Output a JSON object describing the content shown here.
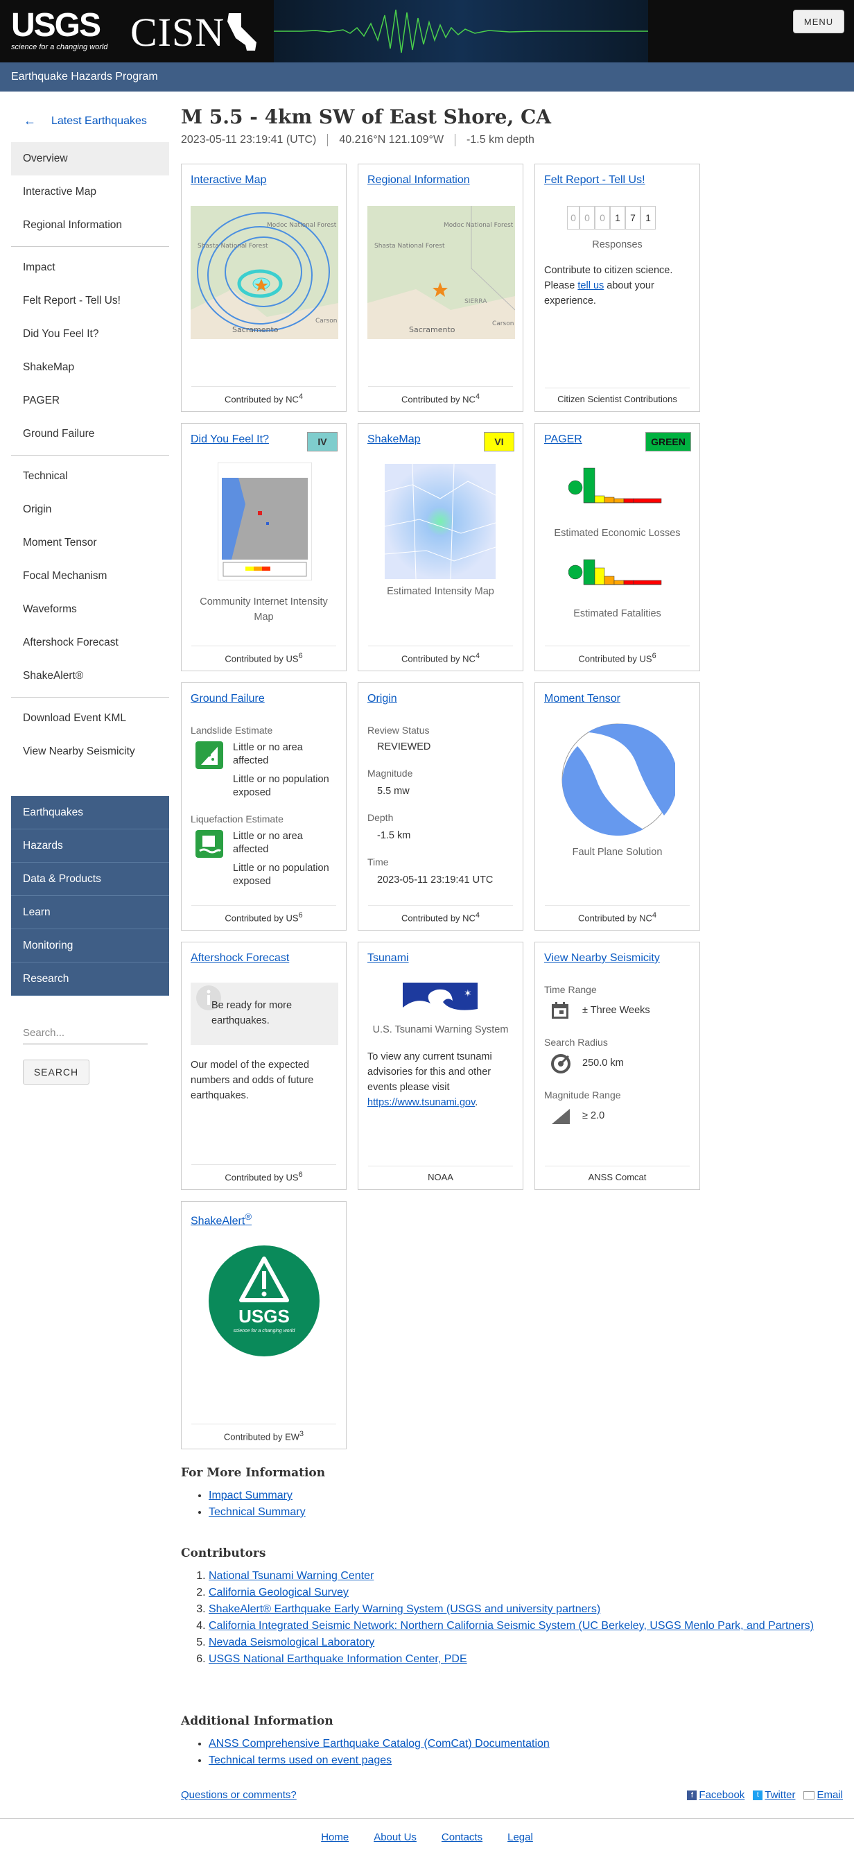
{
  "header": {
    "usgs_word": "USGS",
    "usgs_tagline": "science for a changing world",
    "cisn_word": "CISN",
    "menu_label": "MENU",
    "program": "Earthquake Hazards Program"
  },
  "sidebar": {
    "back_label": "Latest Earthquakes",
    "items": [
      "Overview",
      "Interactive Map",
      "Regional Information",
      "Impact",
      "Felt Report - Tell Us!",
      "Did You Feel It?",
      "ShakeMap",
      "PAGER",
      "Ground Failure",
      "Technical",
      "Origin",
      "Moment Tensor",
      "Focal Mechanism",
      "Waveforms",
      "Aftershock Forecast",
      "ShakeAlert®",
      "Download Event KML",
      "View Nearby Seismicity"
    ],
    "blue_items": [
      "Earthquakes",
      "Hazards",
      "Data & Products",
      "Learn",
      "Monitoring",
      "Research"
    ],
    "search_placeholder": "Search...",
    "search_button": "SEARCH"
  },
  "event": {
    "title": "M 5.5 - 4km SW of East Shore, CA",
    "time": "2023-05-11 23:19:41 (UTC)",
    "location": "40.216°N 121.109°W",
    "depth": "-1.5 km depth"
  },
  "cards": {
    "interactive_map": {
      "title": "Interactive Map",
      "foot_prefix": "Contributed by ",
      "foot_net": "NC",
      "foot_sup": "4",
      "map_labels": [
        "Modoc National Forest",
        "Shasta National Forest",
        "Sacramento",
        "Carson"
      ]
    },
    "regional": {
      "title": "Regional Information",
      "foot_prefix": "Contributed by ",
      "foot_net": "NC",
      "foot_sup": "4",
      "map_labels": [
        "Modoc National Forest",
        "Shasta National Forest",
        "Sacramento",
        "Carson",
        "SIERRA"
      ]
    },
    "felt": {
      "title": "Felt Report - Tell Us!",
      "digits": [
        "0",
        "0",
        "0",
        "1",
        "7",
        "1"
      ],
      "responses": "Responses",
      "text1": "Contribute to citizen science. Please ",
      "link": "tell us",
      "text2": " about your experience.",
      "foot": "Citizen Scientist Contributions"
    },
    "dyfi": {
      "title": "Did You Feel It?",
      "badge": "IV",
      "badge_color": "#7fcdcd",
      "caption": "Community Internet Intensity Map",
      "foot_prefix": "Contributed by ",
      "foot_net": "US",
      "foot_sup": "6"
    },
    "shakemap": {
      "title": "ShakeMap",
      "badge": "VI",
      "badge_color": "#ffff00",
      "caption": "Estimated Intensity Map",
      "foot_prefix": "Contributed by ",
      "foot_net": "NC",
      "foot_sup": "4"
    },
    "pager": {
      "title": "PAGER",
      "badge": "GREEN",
      "badge_color": "#00b140",
      "econ": "Estimated Economic Losses",
      "fatal": "Estimated Fatalities",
      "foot_prefix": "Contributed by ",
      "foot_net": "US",
      "foot_sup": "6"
    },
    "ground": {
      "title": "Ground Failure",
      "landslide_label": "Landslide Estimate",
      "landslide_area": "Little or no area affected",
      "landslide_pop": "Little or no population exposed",
      "liq_label": "Liquefaction Estimate",
      "liq_area": "Little or no area affected",
      "liq_pop": "Little or no population exposed",
      "foot_prefix": "Contributed by ",
      "foot_net": "US",
      "foot_sup": "6"
    },
    "origin": {
      "title": "Origin",
      "review_label": "Review Status",
      "review": "REVIEWED",
      "mag_label": "Magnitude",
      "mag": "5.5 mw",
      "depth_label": "Depth",
      "depth": "-1.5 km",
      "time_label": "Time",
      "time": "2023-05-11 23:19:41 UTC",
      "foot_prefix": "Contributed by ",
      "foot_net": "NC",
      "foot_sup": "4"
    },
    "tensor": {
      "title": "Moment Tensor",
      "caption": "Fault Plane Solution",
      "foot_prefix": "Contributed by ",
      "foot_net": "NC",
      "foot_sup": "4"
    },
    "aftershock": {
      "title": "Aftershock Forecast",
      "ready": "Be ready for more earthquakes.",
      "text": "Our model of the expected numbers and odds of future earthquakes.",
      "foot_prefix": "Contributed by ",
      "foot_net": "US",
      "foot_sup": "6"
    },
    "tsunami": {
      "title": "Tsunami",
      "system": "U.S. Tsunami Warning System",
      "text": "To view any current tsunami advisories for this and other events please visit ",
      "link": "https://www.tsunami.gov",
      "text_end": ".",
      "foot": "NOAA"
    },
    "nearby": {
      "title": "View Nearby Seismicity",
      "time_label": "Time Range",
      "time": "± Three Weeks",
      "radius_label": "Search Radius",
      "radius": "250.0 km",
      "mag_label": "Magnitude Range",
      "mag": "≥ 2.0",
      "foot": "ANSS Comcat"
    },
    "shakealert": {
      "title": "ShakeAlert",
      "title_sup": "®",
      "logo_word": "USGS",
      "logo_tag": "science for a changing world",
      "foot_prefix": "Contributed by ",
      "foot_net": "EW",
      "foot_sup": "3"
    }
  },
  "more_info": {
    "heading": "For More Information",
    "links": [
      "Impact Summary",
      "Technical Summary"
    ]
  },
  "contributors": {
    "heading": "Contributors",
    "items": [
      "National Tsunami Warning Center",
      "California Geological Survey",
      "ShakeAlert® Earthquake Early Warning System (USGS and university partners)",
      "California Integrated Seismic Network: Northern California Seismic System (UC Berkeley, USGS Menlo Park, and Partners)",
      "Nevada Seismological Laboratory",
      "USGS National Earthquake Information Center, PDE"
    ]
  },
  "additional": {
    "heading": "Additional Information",
    "links": [
      "ANSS Comprehensive Earthquake Catalog (ComCat) Documentation",
      "Technical terms used on event pages"
    ]
  },
  "bottom": {
    "questions": "Questions or comments?",
    "facebook": "Facebook",
    "twitter": "Twitter",
    "email": "Email"
  },
  "footer": {
    "links": [
      "Home",
      "About Us",
      "Contacts",
      "Legal"
    ]
  }
}
